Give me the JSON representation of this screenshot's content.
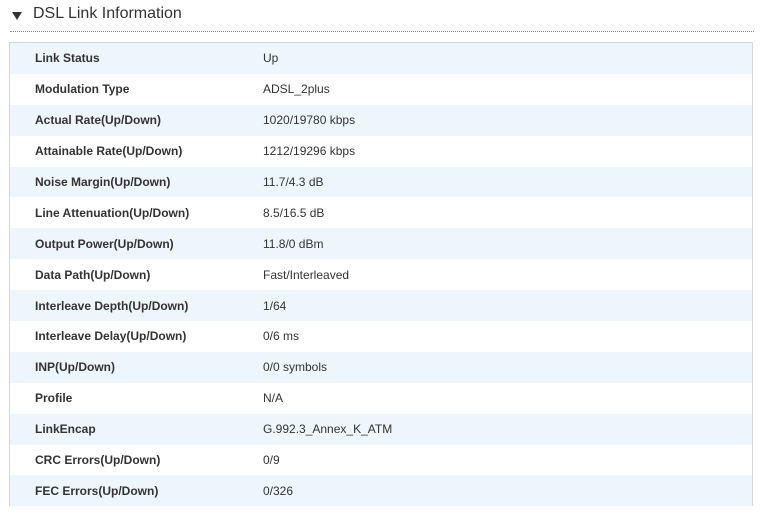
{
  "section": {
    "title": "DSL Link Information",
    "collapse_icon": "triangle-down-icon"
  },
  "rows": [
    {
      "label": "Link Status",
      "value": "Up"
    },
    {
      "label": "Modulation Type",
      "value": "ADSL_2plus"
    },
    {
      "label": "Actual Rate(Up/Down)",
      "value": "1020/19780 kbps"
    },
    {
      "label": "Attainable Rate(Up/Down)",
      "value": "1212/19296 kbps"
    },
    {
      "label": "Noise Margin(Up/Down)",
      "value": "11.7/4.3 dB"
    },
    {
      "label": "Line Attenuation(Up/Down)",
      "value": "8.5/16.5 dB"
    },
    {
      "label": "Output Power(Up/Down)",
      "value": "11.8/0 dBm"
    },
    {
      "label": "Data Path(Up/Down)",
      "value": "Fast/Interleaved"
    },
    {
      "label": "Interleave Depth(Up/Down)",
      "value": "1/64"
    },
    {
      "label": "Interleave Delay(Up/Down)",
      "value": "0/6 ms"
    },
    {
      "label": "INP(Up/Down)",
      "value": "0/0 symbols"
    },
    {
      "label": "Profile",
      "value": "N/A"
    },
    {
      "label": "LinkEncap",
      "value": "G.992.3_Annex_K_ATM"
    },
    {
      "label": "CRC Errors(Up/Down)",
      "value": "0/9"
    },
    {
      "label": "FEC Errors(Up/Down)",
      "value": "0/326"
    }
  ],
  "colors": {
    "row_alt": "#edf6fd",
    "text": "#333333",
    "border": "#d6d6d6"
  }
}
